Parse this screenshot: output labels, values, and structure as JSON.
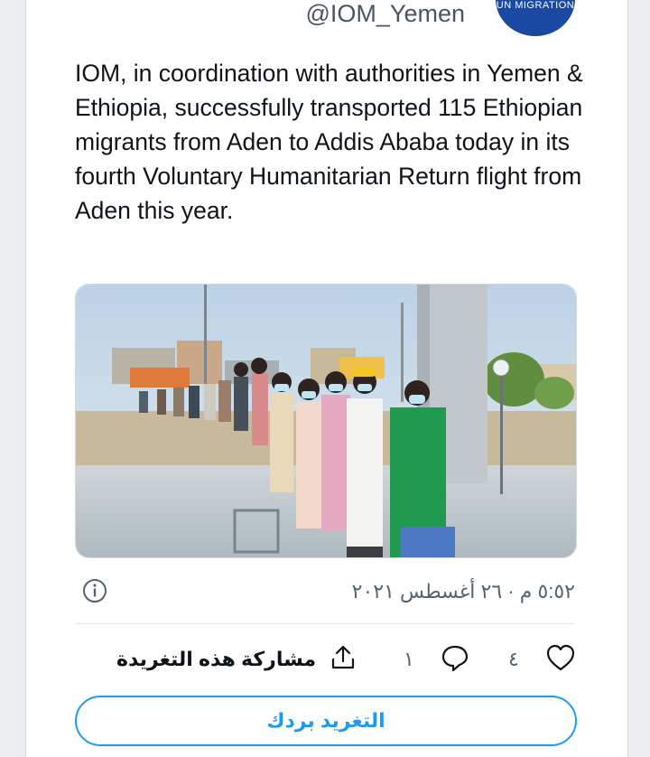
{
  "header": {
    "handle": "@IOM_Yemen",
    "avatar_text": "UN MIGRATION"
  },
  "tweet": {
    "text": "IOM, in coordination with authorities in Yemen & Ethiopia, successfully transported 115 Ethiopian migrants from Aden to Addis Ababa today in its fourth Voluntary Humanitarian Return flight from Aden this year.",
    "timestamp": "٥:٥٢ م · ٢٦ أغسطس ٢٠٢١"
  },
  "actions": {
    "like_count": "٤",
    "reply_count": "١",
    "share_label": "مشاركة هذه التغريدة"
  },
  "reply_button": {
    "label": "التغريد بردك"
  },
  "icons": {
    "info": "info-icon",
    "like": "heart-icon",
    "reply": "speech-bubble-icon",
    "share": "share-upload-icon"
  },
  "colors": {
    "accent": "#1d9bf0",
    "avatar_bg": "#1a49a3",
    "secondary_text": "#536471"
  }
}
